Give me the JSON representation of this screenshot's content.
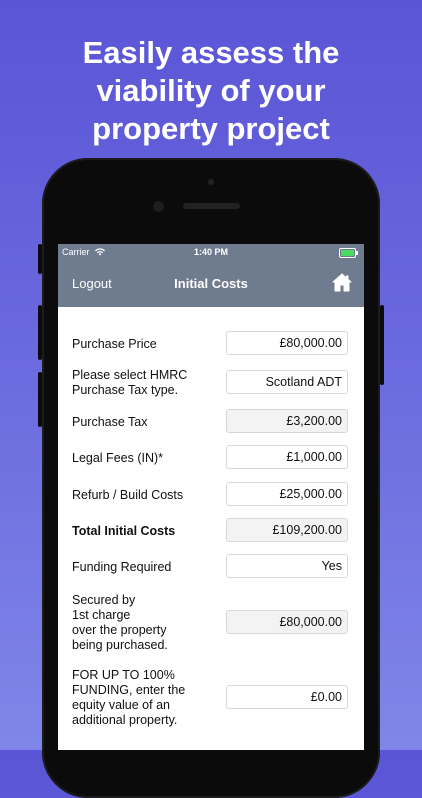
{
  "headline": [
    "Easily assess the",
    "viability of your",
    "property project"
  ],
  "status_bar": {
    "carrier": "Carrier",
    "time": "1:40 PM"
  },
  "nav": {
    "left": "Logout",
    "title": "Initial Costs",
    "right_icon": "home-icon"
  },
  "form": [
    {
      "label": "Purchase Price",
      "value": "£80,000.00",
      "editable": true
    },
    {
      "label": "Please select HMRC\nPurchase Tax type.",
      "value": "Scotland ADT",
      "editable": true
    },
    {
      "label": "Purchase Tax",
      "value": "£3,200.00",
      "editable": false
    },
    {
      "label": "Legal Fees (IN)*",
      "value": "£1,000.00",
      "editable": true
    },
    {
      "label": "Refurb / Build Costs",
      "value": "£25,000.00",
      "editable": true
    },
    {
      "label": "Total Initial Costs",
      "value": "£109,200.00",
      "editable": false
    },
    {
      "label": "Funding Required",
      "value": "Yes",
      "editable": true
    },
    {
      "label": "Secured by\n1st charge\nover the property\nbeing purchased.",
      "value": "£80,000.00",
      "editable": false
    },
    {
      "label": "FOR UP TO 100%\nFUNDING, enter the\nequity value of an\nadditional property.",
      "value": "£0.00",
      "editable": true
    }
  ]
}
